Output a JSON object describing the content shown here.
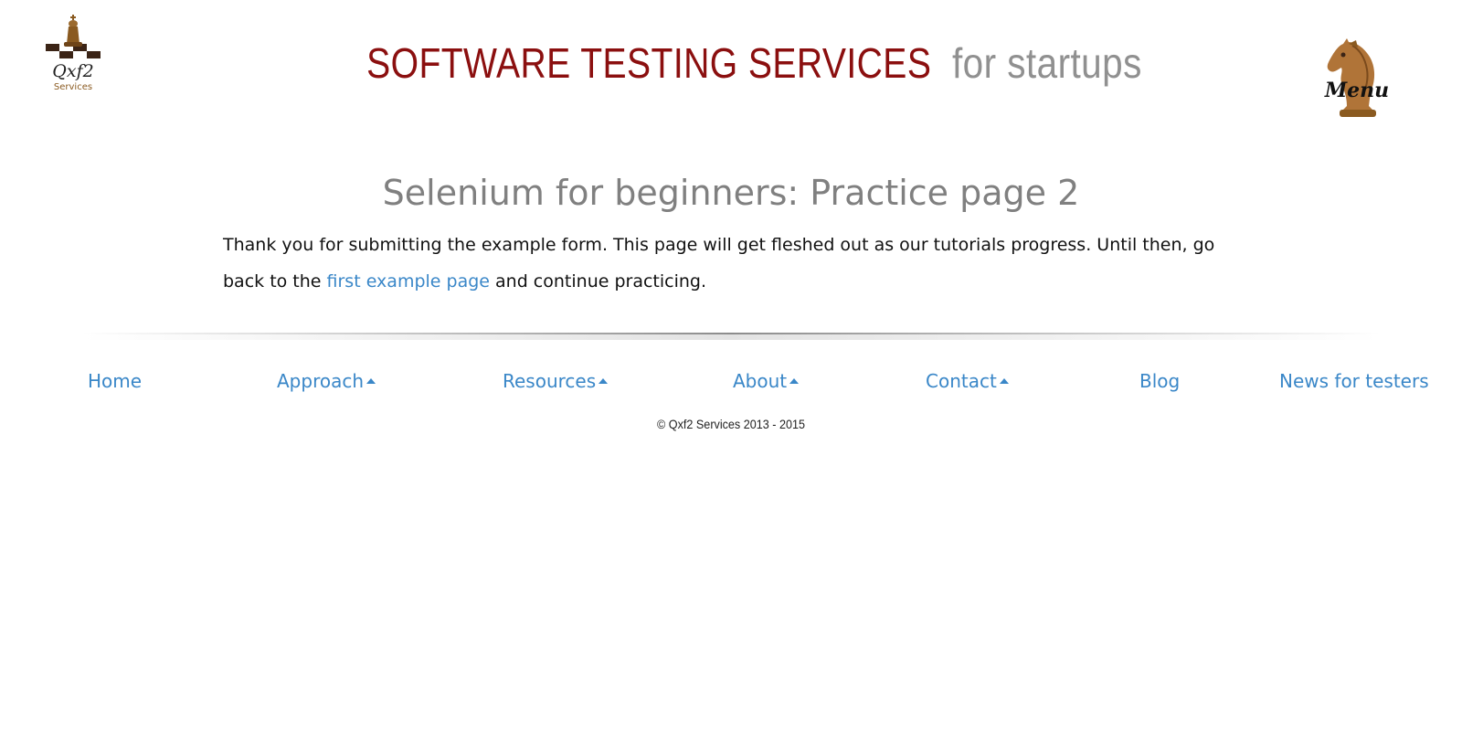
{
  "header": {
    "logo": {
      "icon": "chess-king-icon",
      "text": "Qxf2",
      "subtext": "Services"
    },
    "headline_primary": "SOFTWARE TESTING SERVICES",
    "headline_secondary": "for startups",
    "menu": {
      "icon": "chess-knight-icon",
      "label": "Menu"
    }
  },
  "main": {
    "title": "Selenium for beginners: Practice page 2",
    "body_before_link": "Thank you for submitting the example form. This page will get fleshed out as our tutorials progress. Until then, go back to the ",
    "link_text": "first example page",
    "body_after_link": " and continue practicing."
  },
  "footer": {
    "nav": [
      {
        "label": "Home",
        "has_caret": false
      },
      {
        "label": "Approach",
        "has_caret": true
      },
      {
        "label": "Resources",
        "has_caret": true
      },
      {
        "label": "About",
        "has_caret": true
      },
      {
        "label": "Contact",
        "has_caret": true
      },
      {
        "label": "Blog",
        "has_caret": false
      },
      {
        "label": "News for testers",
        "has_caret": false
      }
    ],
    "copyright": "© Qxf2 Services 2013 - 2015"
  },
  "colors": {
    "headline_primary": "#8b0f0f",
    "headline_secondary": "#909090",
    "link": "#3a87c8",
    "title": "#808080",
    "logo_brown": "#8a5a20"
  }
}
